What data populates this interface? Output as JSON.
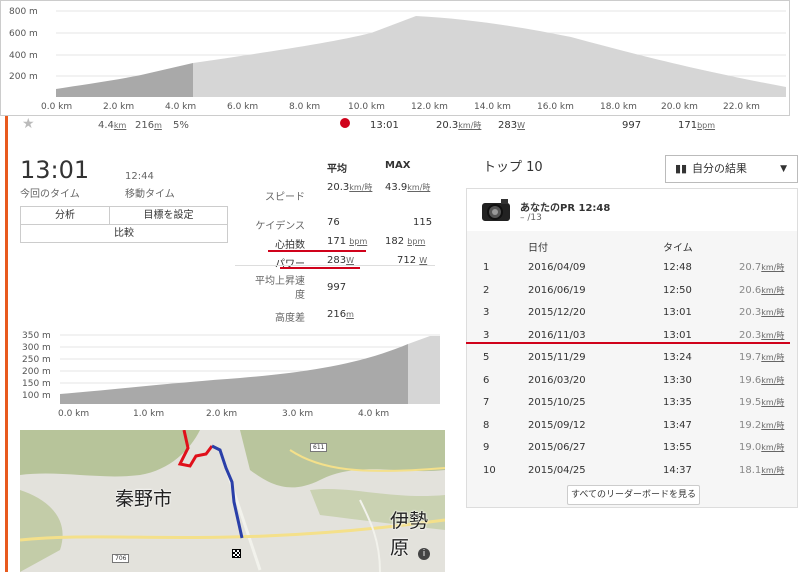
{
  "elevation_top": {
    "y_ticks": [
      "800 m",
      "600 m",
      "400 m",
      "200 m"
    ],
    "x_ticks": [
      "0.0 km",
      "2.0 km",
      "4.0 km",
      "6.0 km",
      "8.0 km",
      "10.0 km",
      "12.0 km",
      "14.0 km",
      "16.0 km",
      "18.0 km",
      "20.0 km",
      "22.0 km"
    ]
  },
  "segment_row": {
    "dist": "4.4",
    "dist_unit": "km",
    "elev": "216",
    "elev_unit": "m",
    "grade": "5%",
    "time": "13:01",
    "speed": "20.3",
    "speed_unit": "km/時",
    "power": "283",
    "power_unit": "W",
    "rise": "997",
    "hr": "171",
    "hr_unit": "bpm"
  },
  "summary": {
    "time": "13:01",
    "time_label": "今回のタイム",
    "moving_time": "12:44",
    "moving_label": "移動タイム",
    "analysis": "分析",
    "goals": "目標を設定",
    "compare": "比較"
  },
  "stats": {
    "col_avg": "平均",
    "col_max": "MAX",
    "rows": [
      {
        "label": "スピード",
        "avg": "20.3",
        "avg_unit": "km/時",
        "max": "43.9",
        "max_unit": "km/時"
      },
      {
        "label": "ケイデンス",
        "avg": "76",
        "avg_unit": "",
        "max": "115",
        "max_unit": ""
      },
      {
        "label": "心拍数",
        "avg": "171",
        "avg_unit": "bpm",
        "max": "182",
        "max_unit": "bpm"
      },
      {
        "label": "パワー",
        "avg": "283",
        "avg_unit": "W",
        "max": "712",
        "max_unit": "W"
      },
      {
        "label": "平均上昇速度",
        "avg": "997",
        "avg_unit": "",
        "max": "",
        "max_unit": ""
      },
      {
        "label": "高度差",
        "avg": "216",
        "avg_unit": "m",
        "max": "",
        "max_unit": ""
      }
    ]
  },
  "elevation_mid": {
    "y_ticks": [
      "350 m",
      "300 m",
      "250 m",
      "200 m",
      "150 m",
      "100 m"
    ],
    "x_ticks": [
      "0.0 km",
      "1.0 km",
      "2.0 km",
      "3.0 km",
      "4.0 km"
    ]
  },
  "map": {
    "city": "秦野市",
    "city2": "伊勢原",
    "road1": "611",
    "road2": "706"
  },
  "top10": {
    "title": "トップ 10",
    "filter": "自分の結果",
    "pr_label": "あなたのPR 12:48",
    "pr_rank": "– /13",
    "col_date": "日付",
    "col_time": "タイム",
    "rows": [
      {
        "rank": "1",
        "date": "2016/04/09",
        "time": "12:48",
        "speed": "20.7",
        "unit": "km/時"
      },
      {
        "rank": "2",
        "date": "2016/06/19",
        "time": "12:50",
        "speed": "20.6",
        "unit": "km/時"
      },
      {
        "rank": "3",
        "date": "2015/12/20",
        "time": "13:01",
        "speed": "20.3",
        "unit": "km/時"
      },
      {
        "rank": "3",
        "date": "2016/11/03",
        "time": "13:01",
        "speed": "20.3",
        "unit": "km/時"
      },
      {
        "rank": "5",
        "date": "2015/11/29",
        "time": "13:24",
        "speed": "19.7",
        "unit": "km/時"
      },
      {
        "rank": "6",
        "date": "2016/03/20",
        "time": "13:30",
        "speed": "19.6",
        "unit": "km/時"
      },
      {
        "rank": "7",
        "date": "2015/10/25",
        "time": "13:35",
        "speed": "19.5",
        "unit": "km/時"
      },
      {
        "rank": "8",
        "date": "2015/09/12",
        "time": "13:47",
        "speed": "19.2",
        "unit": "km/時"
      },
      {
        "rank": "9",
        "date": "2015/06/27",
        "time": "13:55",
        "speed": "19.0",
        "unit": "km/時"
      },
      {
        "rank": "10",
        "date": "2015/04/25",
        "time": "14:37",
        "speed": "18.1",
        "unit": "km/時"
      }
    ],
    "leaderboard_btn": "すべてのリーダーボードを見る"
  },
  "colors": {
    "accent": "#e85a1e",
    "highlight": "#d0021b",
    "route_red": "#e0101a",
    "route_blue": "#2a3fa8"
  }
}
